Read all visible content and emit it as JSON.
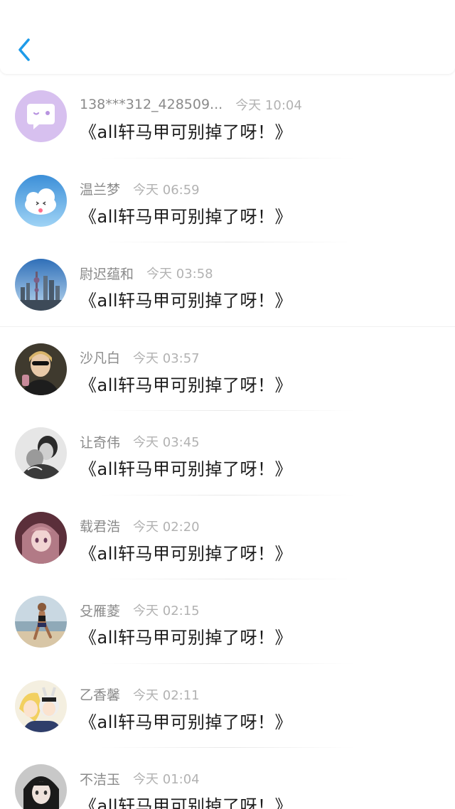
{
  "header": {
    "back_icon": "chevron-left-icon",
    "accent": "#1e9be9"
  },
  "items": [
    {
      "name": "138***312_428509...",
      "time": "今天 10:04",
      "message": "《all轩马甲可别掉了呀！》",
      "avatar": "chat-bubble-avatar"
    },
    {
      "name": "温兰梦",
      "time": "今天 06:59",
      "message": "《all轩马甲可别掉了呀！》",
      "avatar": "cloud-avatar"
    },
    {
      "name": "尉迟蕴和",
      "time": "今天 03:58",
      "message": "《all轩马甲可别掉了呀！》",
      "avatar": "city-skyline-avatar"
    },
    {
      "name": "沙凡白",
      "time": "今天 03:57",
      "message": "《all轩马甲可别掉了呀！》",
      "avatar": "portrait-avatar"
    },
    {
      "name": "让奇伟",
      "time": "今天 03:45",
      "message": "《all轩马甲可别掉了呀！》",
      "avatar": "bw-portrait-avatar"
    },
    {
      "name": "载君浩",
      "time": "今天 02:20",
      "message": "《all轩马甲可别掉了呀！》",
      "avatar": "anime-girl-avatar"
    },
    {
      "name": "殳雁菱",
      "time": "今天 02:15",
      "message": "《all轩马甲可别掉了呀！》",
      "avatar": "beach-runner-avatar"
    },
    {
      "name": "乙香馨",
      "time": "今天 02:11",
      "message": "《all轩马甲可别掉了呀！》",
      "avatar": "anime-characters-avatar"
    },
    {
      "name": "不洁玉",
      "time": "今天 01:04",
      "message": "《all轩马甲可别掉了呀！》",
      "avatar": "dark-hair-girl-avatar"
    }
  ]
}
